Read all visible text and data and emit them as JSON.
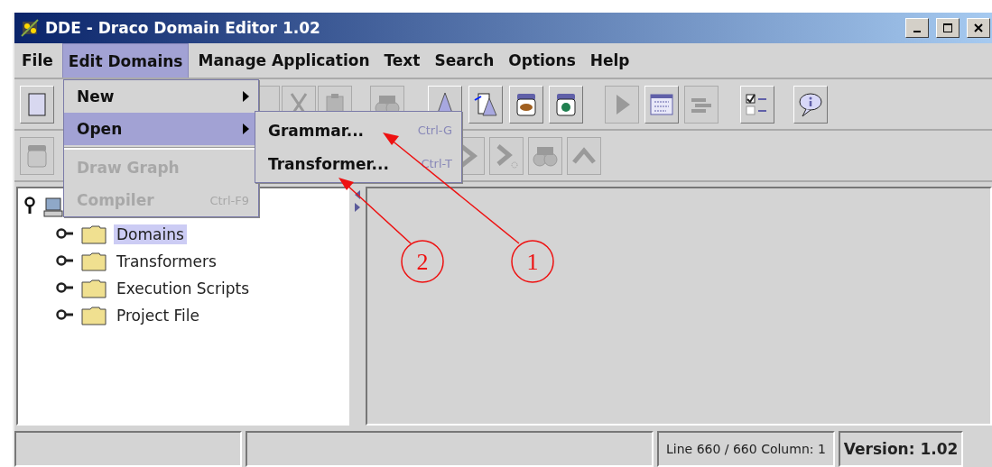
{
  "window": {
    "title": "DDE - Draco Domain Editor 1.02"
  },
  "menu_bar": [
    {
      "label": "File",
      "selected": false
    },
    {
      "label": "Edit Domains",
      "selected": true
    },
    {
      "label": "Manage Application",
      "selected": false
    },
    {
      "label": "Text",
      "selected": false
    },
    {
      "label": "Search",
      "selected": false
    },
    {
      "label": "Options",
      "selected": false
    },
    {
      "label": "Help",
      "selected": false
    }
  ],
  "toolbar_1": [
    {
      "disabled": false
    },
    {
      "disabled": true
    },
    {
      "disabled": true
    },
    {
      "disabled": true
    },
    {
      "disabled": true
    },
    {
      "disabled": false
    },
    {
      "disabled": false
    },
    {
      "disabled": false
    },
    {
      "disabled": false
    },
    {
      "disabled": true
    },
    {
      "disabled": false
    },
    {
      "disabled": true
    },
    {
      "disabled": false
    },
    {
      "disabled": false
    }
  ],
  "toolbar_2": [
    {
      "disabled": true
    },
    {
      "disabled": true
    },
    {
      "disabled": true
    },
    {
      "disabled": true
    },
    {
      "disabled": true
    }
  ],
  "edit_domains_menu": [
    {
      "kind": "submenu",
      "label": "New",
      "selected": false,
      "disabled": false
    },
    {
      "kind": "submenu",
      "label": "Open",
      "selected": true,
      "disabled": false
    },
    {
      "kind": "separator"
    },
    {
      "kind": "item",
      "label": "Draw Graph",
      "selected": false,
      "disabled": true
    },
    {
      "kind": "item",
      "label": "Compiler",
      "shortcut": "Ctrl-F9",
      "selected": false,
      "disabled": true
    }
  ],
  "open_submenu": [
    {
      "label": "Grammar...",
      "shortcut": "Ctrl-G"
    },
    {
      "label": "Transformer...",
      "shortcut": "Ctrl-T"
    }
  ],
  "tree": {
    "expanded": true,
    "children": [
      {
        "label": "Domains",
        "selected": true,
        "expanded": false
      },
      {
        "label": "Transformers",
        "selected": false,
        "expanded": false
      },
      {
        "label": "Execution Scripts",
        "selected": false,
        "expanded": false
      },
      {
        "label": "Project File",
        "selected": false,
        "expanded": false
      }
    ]
  },
  "status_bar": {
    "position": "Line 660 / 660  Column:  1",
    "version": "Version: 1.02"
  },
  "annotations": [
    {
      "label": "2"
    },
    {
      "label": "1"
    }
  ]
}
